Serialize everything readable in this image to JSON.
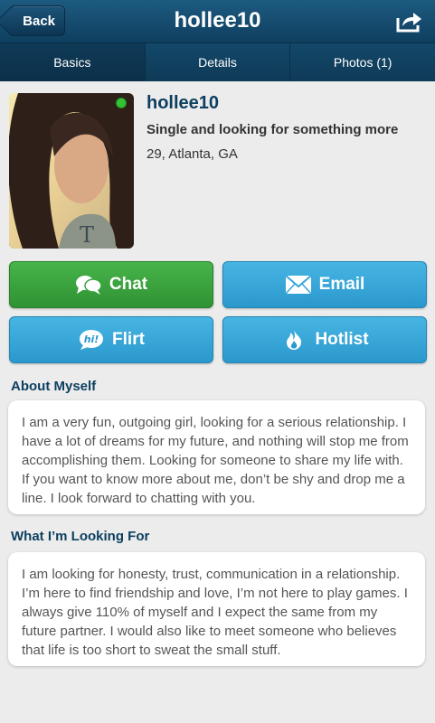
{
  "header": {
    "back_label": "Back",
    "title": "hollee10",
    "share_icon": "share-icon"
  },
  "tabs": [
    {
      "label": "Basics",
      "active": true
    },
    {
      "label": "Details",
      "active": false
    },
    {
      "label": "Photos (1)",
      "active": false
    }
  ],
  "profile": {
    "username": "hollee10",
    "tagline": "Single and looking for something more",
    "age_location": "29, Atlanta, GA",
    "online": true
  },
  "actions": {
    "chat_label": "Chat",
    "email_label": "Email",
    "flirt_label": "Flirt",
    "hotlist_label": "Hotlist"
  },
  "about": {
    "heading": "About Myself",
    "text": "I am a very fun, outgoing girl, looking for a serious relationship. I have a lot of dreams for my future, and nothing will stop me from accomplishing them. Looking for someone to share my life with. If you want to know more about me, don’t be shy and drop me a line. I look forward to chatting with you."
  },
  "looking_for": {
    "heading": "What I’m Looking For",
    "text": "I am looking for honesty, trust, communication in a relationship. I’m here to find friendship and love, I’m not here to play games. I always give 110% of myself and I expect the same from my future partner. I would also like to meet someone who believes that life is too short to sweat the small stuff."
  },
  "colors": {
    "header": "#0f3f5f",
    "accent_blue": "#2a98cc",
    "accent_green": "#2f9233",
    "heading_text": "#0d3f60"
  }
}
